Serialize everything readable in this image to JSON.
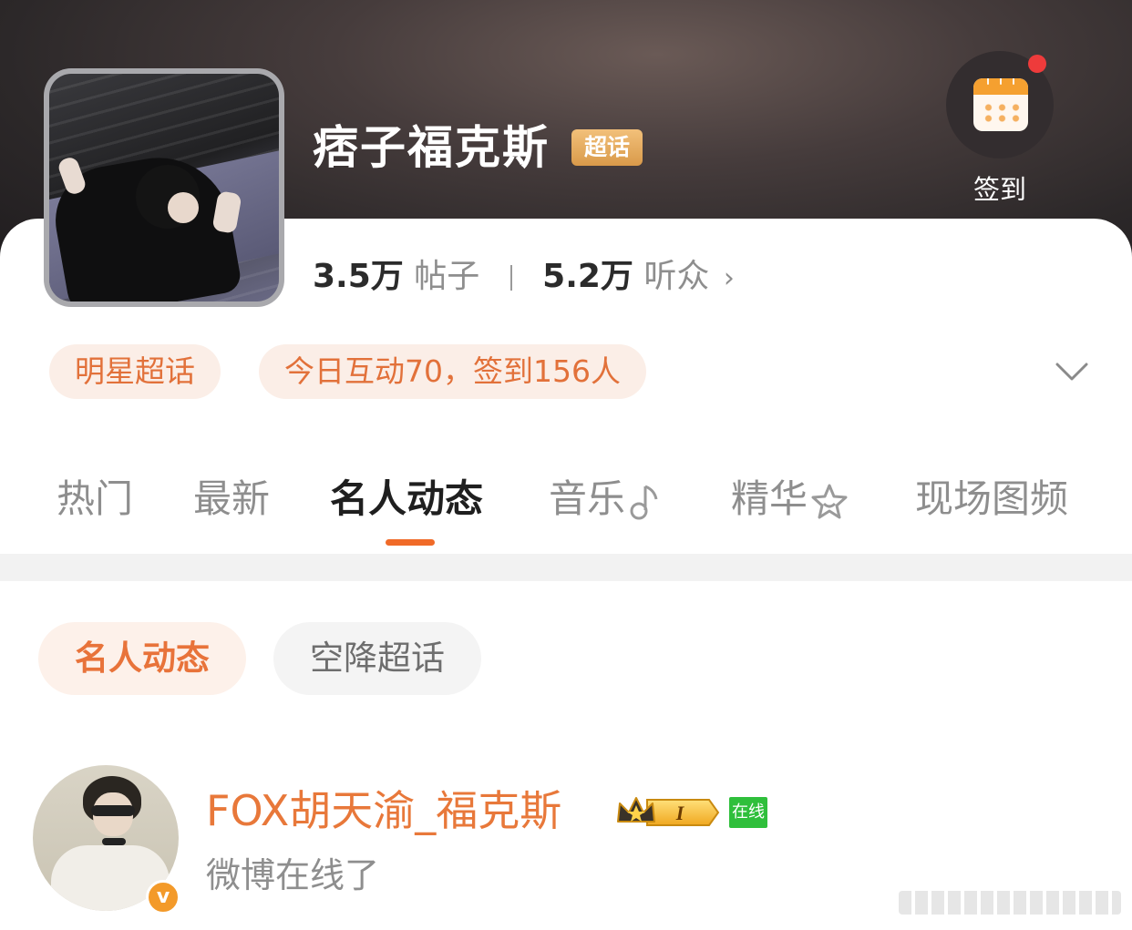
{
  "header": {
    "title": "痞子福克斯",
    "badge": "超话",
    "checkin_label": "签到",
    "stats": {
      "posts_count": "3.5万",
      "posts_label": "帖子",
      "fans_count": "5.2万",
      "fans_label": "听众"
    }
  },
  "info_pills": {
    "category": "明星超话",
    "activity": "今日互动70，签到156人"
  },
  "tabs": [
    {
      "label": "热门"
    },
    {
      "label": "最新"
    },
    {
      "label": "名人动态"
    },
    {
      "label": "音乐"
    },
    {
      "label": "精华"
    },
    {
      "label": "现场图频"
    }
  ],
  "active_tab": "名人动态",
  "filters": {
    "chip_active": "名人动态",
    "chip_other": "空降超话"
  },
  "feed": {
    "user_name": "FOX胡天渝_福克斯",
    "level_badge": "I",
    "online_badge": "在线",
    "verified_badge": "v",
    "status_text": "微博在线了"
  },
  "colors": {
    "accent": "#f06a28",
    "pill_text": "#e2713a",
    "online_green": "#2fbf3b"
  }
}
